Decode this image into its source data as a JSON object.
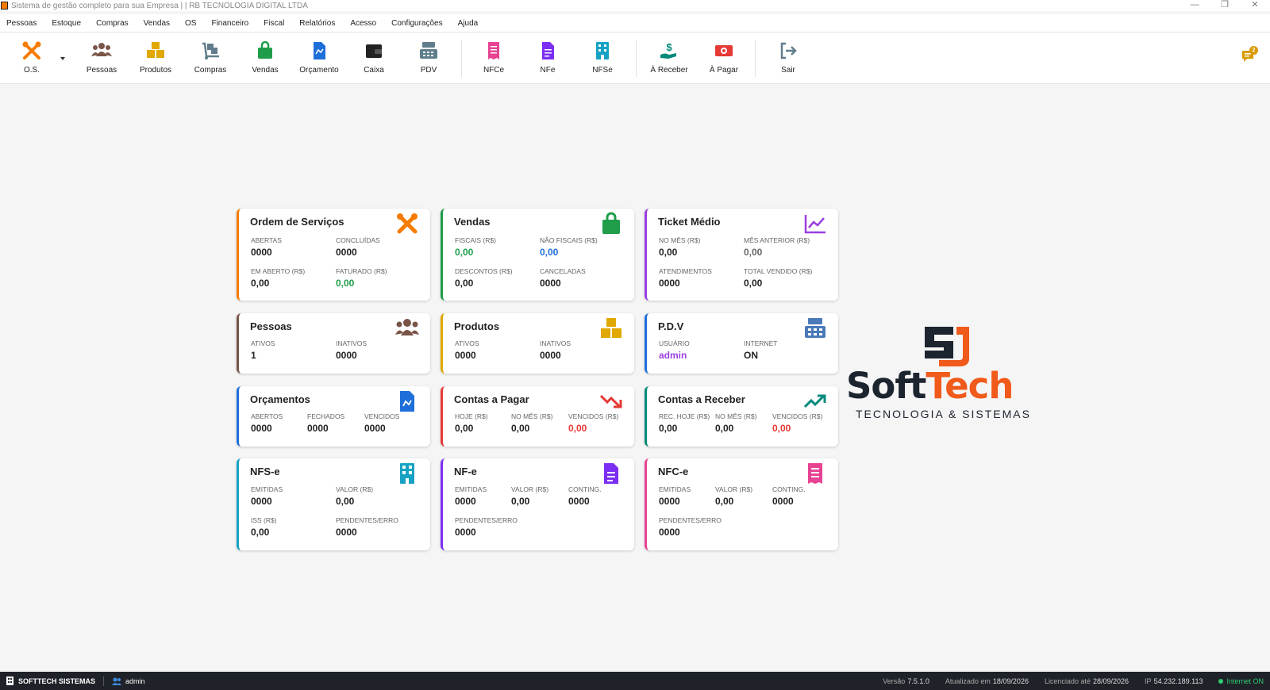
{
  "window": {
    "title": "Sistema de gestão completo para sua Empresa |  | RB TECNOLOGIA DIGITAL LTDA",
    "minimize": "—",
    "restore": "❐",
    "close": "✕"
  },
  "menu": [
    "Pessoas",
    "Estoque",
    "Compras",
    "Vendas",
    "OS",
    "Financeiro",
    "Fiscal",
    "Relatórios",
    "Acesso",
    "Configurações",
    "Ajuda"
  ],
  "toolbar": {
    "os": "O.S.",
    "pessoas": "Pessoas",
    "produtos": "Produtos",
    "compras": "Compras",
    "vendas": "Vendas",
    "orcamento": "Orçamento",
    "caixa": "Caixa",
    "pdv": "PDV",
    "nfce": "NFCe",
    "nfe": "NFe",
    "nfse": "NFSe",
    "receber": "À Receber",
    "pagar": "À Pagar",
    "sair": "Sair",
    "notifications": "2"
  },
  "colors": {
    "orange": "#f57c00",
    "brown": "#795548",
    "yellow": "#e0a800",
    "gray": "#607d8b",
    "green": "#1f9d4a",
    "blue": "#1e6fd9",
    "purple": "#9b3fe0",
    "red": "#e53935",
    "teal": "#00897b",
    "cyan": "#17a2c4",
    "pink": "#e84393"
  },
  "cards": {
    "os": {
      "title": "Ordem de Serviços",
      "abertas_l": "ABERTAS",
      "abertas_v": "0000",
      "concluidas_l": "CONCLUÍDAS",
      "concluidas_v": "0000",
      "emaberto_l": "EM ABERTO (R$)",
      "emaberto_v": "0,00",
      "faturado_l": "FATURADO (R$)",
      "faturado_v": "0,00"
    },
    "vendas": {
      "title": "Vendas",
      "fiscais_l": "FISCAIS (R$)",
      "fiscais_v": "0,00",
      "naofiscais_l": "NÃO FISCAIS (R$)",
      "naofiscais_v": "0,00",
      "descontos_l": "DESCONTOS (R$)",
      "descontos_v": "0,00",
      "canceladas_l": "CANCELADAS",
      "canceladas_v": "0000"
    },
    "ticket": {
      "title": "Ticket Médio",
      "nomes_l": "NO MÊS (R$)",
      "nomes_v": "0,00",
      "mesant_l": "MÊS ANTERIOR (R$)",
      "mesant_v": "0,00",
      "atend_l": "ATENDIMENTOS",
      "atend_v": "0000",
      "total_l": "TOTAL VENDIDO (R$)",
      "total_v": "0,00"
    },
    "pessoas": {
      "title": "Pessoas",
      "ativos_l": "ATIVOS",
      "ativos_v": "1",
      "inativos_l": "INATIVOS",
      "inativos_v": "0000"
    },
    "produtos": {
      "title": "Produtos",
      "ativos_l": "ATIVOS",
      "ativos_v": "0000",
      "inativos_l": "INATIVOS",
      "inativos_v": "0000"
    },
    "pdv": {
      "title": "P.D.V",
      "usuario_l": "USUÁRIO",
      "usuario_v": "admin",
      "internet_l": "INTERNET",
      "internet_v": "ON"
    },
    "orcamentos": {
      "title": "Orçamentos",
      "abertos_l": "ABERTOS",
      "abertos_v": "0000",
      "fechados_l": "FECHADOS",
      "fechados_v": "0000",
      "vencidos_l": "VENCIDOS",
      "vencidos_v": "0000"
    },
    "pagar": {
      "title": "Contas a Pagar",
      "hoje_l": "HOJE (R$)",
      "hoje_v": "0,00",
      "nomes_l": "NO MÊS (R$)",
      "nomes_v": "0,00",
      "vencidos_l": "VENCIDOS (R$)",
      "vencidos_v": "0,00"
    },
    "receber": {
      "title": "Contas a Receber",
      "rechoje_l": "REC. HOJE (R$)",
      "rechoje_v": "0,00",
      "nomes_l": "NO MÊS (R$)",
      "nomes_v": "0,00",
      "vencidos_l": "VENCIDOS (R$)",
      "vencidos_v": "0,00"
    },
    "nfse": {
      "title": "NFS-e",
      "emitidas_l": "EMITIDAS",
      "emitidas_v": "0000",
      "valor_l": "VALOR (R$)",
      "valor_v": "0,00",
      "iss_l": "ISS (R$)",
      "iss_v": "0,00",
      "pend_l": "PENDENTES/ERRO",
      "pend_v": "0000"
    },
    "nfe": {
      "title": "NF-e",
      "emitidas_l": "EMITIDAS",
      "emitidas_v": "0000",
      "valor_l": "VALOR (R$)",
      "valor_v": "0,00",
      "conting_l": "CONTING.",
      "conting_v": "0000",
      "pend_l": "PENDENTES/ERRO",
      "pend_v": "0000"
    },
    "nfce": {
      "title": "NFC-e",
      "emitidas_l": "EMITIDAS",
      "emitidas_v": "0000",
      "valor_l": "VALOR (R$)",
      "valor_v": "0,00",
      "conting_l": "CONTING.",
      "conting_v": "0000",
      "pend_l": "PENDENTES/ERRO",
      "pend_v": "0000"
    }
  },
  "logo": {
    "soft": "Soft",
    "tech": "Tech",
    "tagline": "TECNOLOGIA & SISTEMAS"
  },
  "status": {
    "company": "SOFTTECH SISTEMAS",
    "user": "admin",
    "versao_l": "Versão",
    "versao_v": "7.5.1.0",
    "atualizado_l": "Atualizado em",
    "atualizado_v": "18/09/2026",
    "licenciado_l": "Licenciado até",
    "licenciado_v": "28/09/2026",
    "ip_l": "IP",
    "ip_v": "54.232.189.113",
    "internet": "Internet ON"
  }
}
